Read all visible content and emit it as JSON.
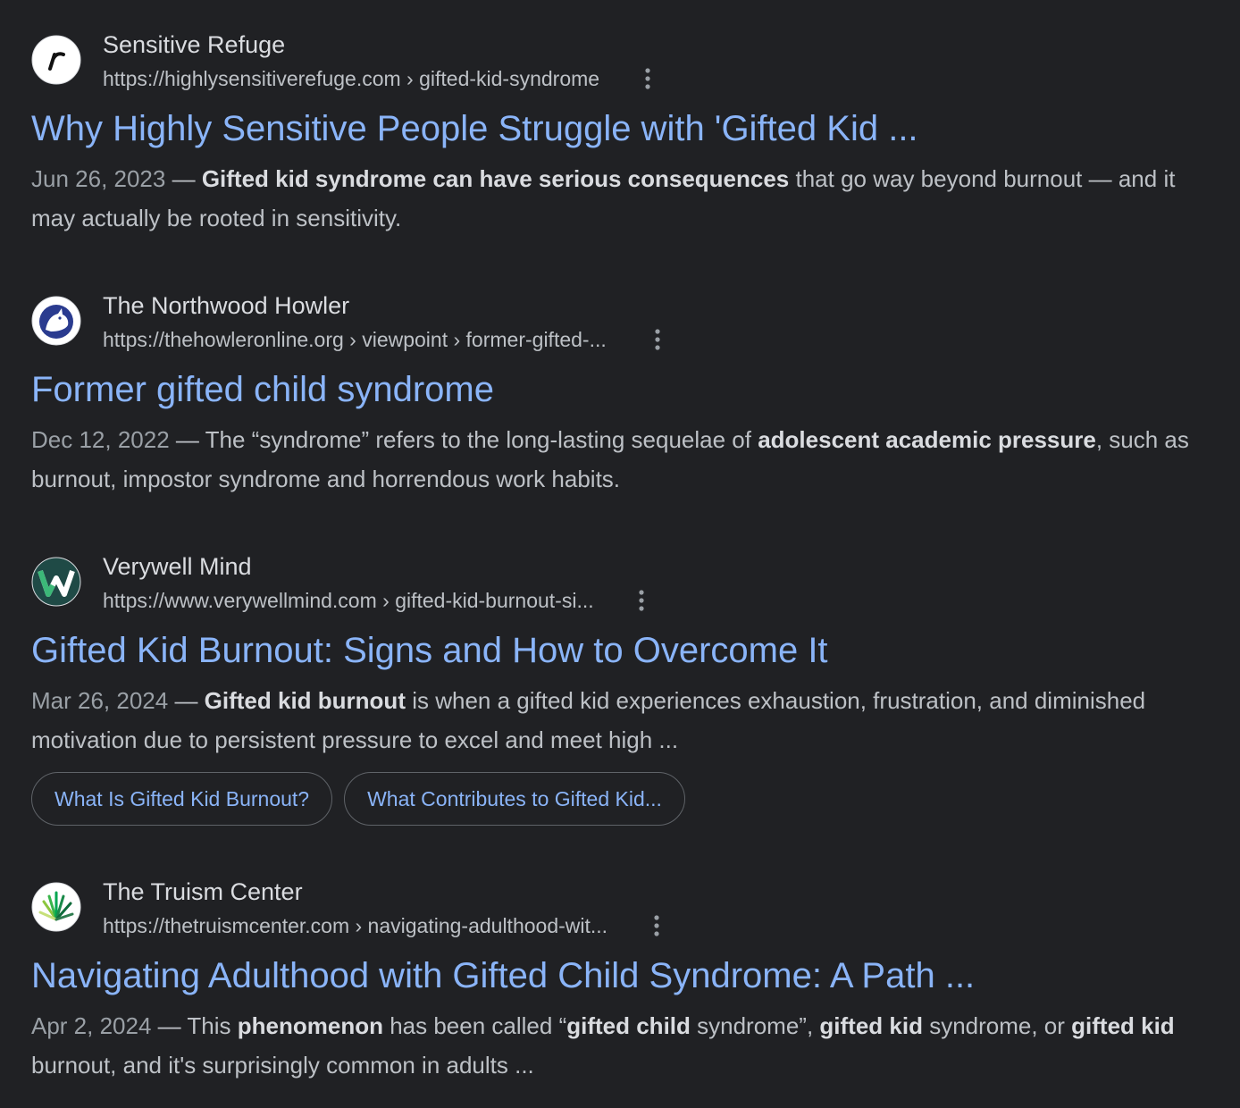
{
  "results": [
    {
      "site_name": "Sensitive Refuge",
      "url": "https://highlysensitiverefuge.com › gifted-kid-syndrome",
      "title": "Why Highly Sensitive People Struggle with 'Gifted Kid ...",
      "date": "Jun 26, 2023",
      "dash": " — ",
      "snippet": [
        {
          "text": "Gifted kid syndrome can have serious consequences",
          "bold": true
        },
        {
          "text": " that go way beyond burnout — and it may actually be rooted in sensitivity.",
          "bold": false
        }
      ],
      "icon": "sensitive-refuge-logo-icon"
    },
    {
      "site_name": "The Northwood Howler",
      "url": "https://thehowleronline.org › viewpoint › former-gifted-...",
      "title": "Former gifted child syndrome",
      "date": "Dec 12, 2022",
      "dash": " — ",
      "snippet": [
        {
          "text": "The “syndrome” refers to the long-lasting sequelae of ",
          "bold": false
        },
        {
          "text": "adolescent academic pressure",
          "bold": true
        },
        {
          "text": ", such as burnout, impostor syndrome and horrendous work habits.",
          "bold": false
        }
      ],
      "icon": "howler-wolf-logo-icon"
    },
    {
      "site_name": "Verywell Mind",
      "url": "https://www.verywellmind.com › gifted-kid-burnout-si...",
      "title": "Gifted Kid Burnout: Signs and How to Overcome It",
      "date": "Mar 26, 2024",
      "dash": " — ",
      "snippet": [
        {
          "text": "Gifted kid burnout",
          "bold": true
        },
        {
          "text": " is when a gifted kid experiences exhaustion, frustration, and diminished motivation due to persistent pressure to excel and meet high ...",
          "bold": false
        }
      ],
      "chips": [
        "What Is Gifted Kid Burnout?",
        "What Contributes to Gifted Kid..."
      ],
      "icon": "verywell-w-logo-icon"
    },
    {
      "site_name": "The Truism Center",
      "url": "https://thetruismcenter.com › navigating-adulthood-wit...",
      "title": "Navigating Adulthood with Gifted Child Syndrome: A Path ...",
      "date": "Apr 2, 2024",
      "dash": " — ",
      "snippet": [
        {
          "text": "This ",
          "bold": false
        },
        {
          "text": "phenomenon",
          "bold": true
        },
        {
          "text": " has been called “",
          "bold": false
        },
        {
          "text": "gifted child",
          "bold": true
        },
        {
          "text": " syndrome”, ",
          "bold": false
        },
        {
          "text": "gifted kid",
          "bold": true
        },
        {
          "text": " syndrome, or ",
          "bold": false
        },
        {
          "text": "gifted kid",
          "bold": true
        },
        {
          "text": " burnout, and it's surprisingly common in adults ...",
          "bold": false
        }
      ],
      "icon": "truism-plant-logo-icon"
    }
  ],
  "colors": {
    "background": "#202124",
    "title_link": "#8ab4f8",
    "site_name": "#dadce0",
    "snippet": "#bdc1c6",
    "date": "#9aa0a6"
  }
}
